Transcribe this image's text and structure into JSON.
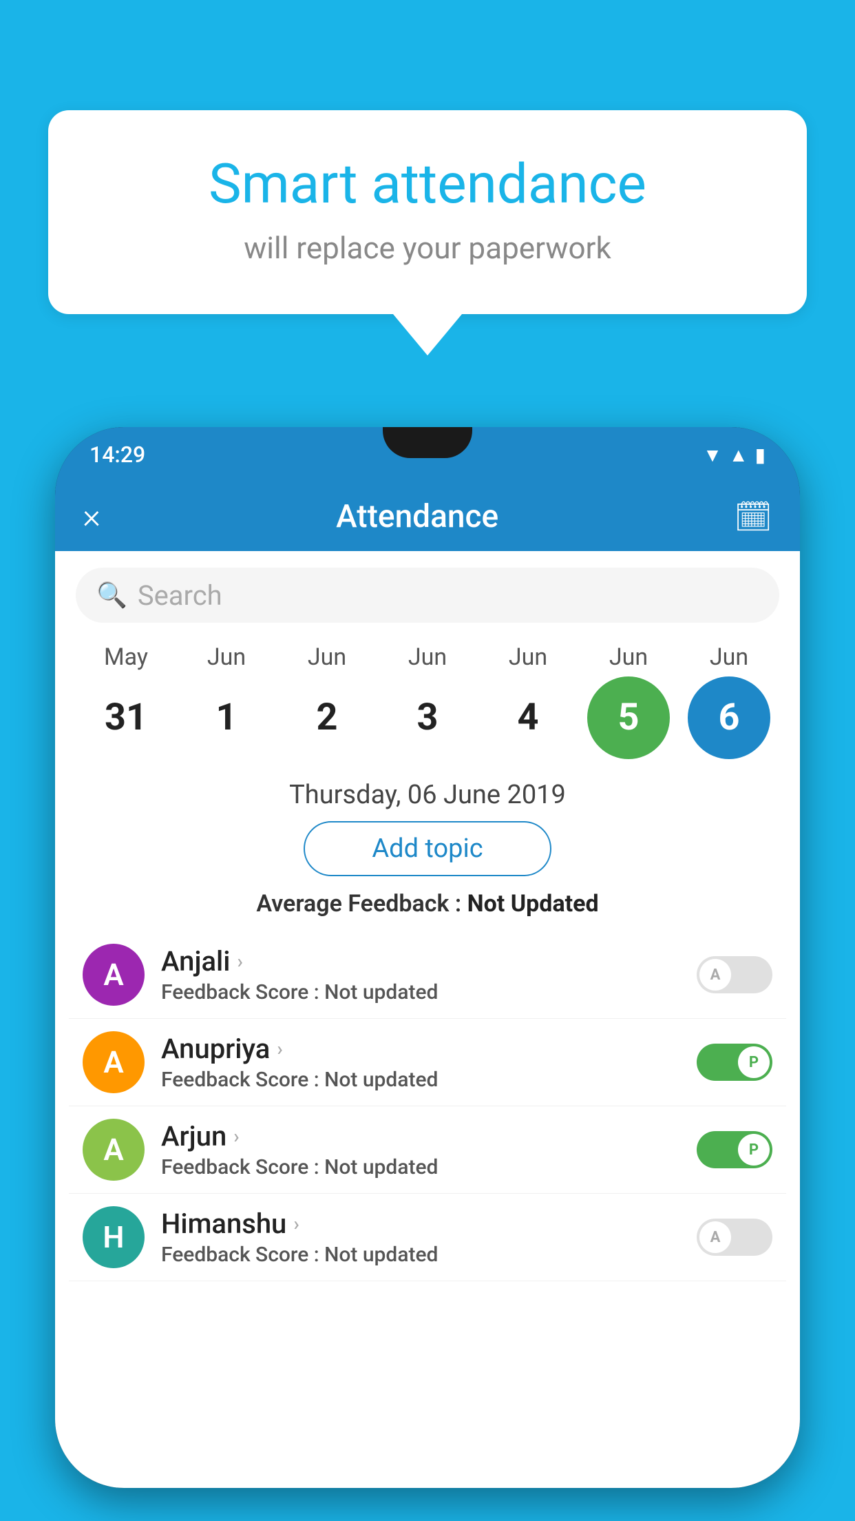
{
  "background_color": "#1ab4e8",
  "speech_bubble": {
    "title": "Smart attendance",
    "subtitle": "will replace your paperwork"
  },
  "phone": {
    "status_bar": {
      "time": "14:29",
      "icons": [
        "wifi",
        "signal",
        "battery"
      ]
    },
    "header": {
      "close_icon": "×",
      "title": "Attendance",
      "calendar_icon": "📅"
    },
    "search": {
      "placeholder": "Search"
    },
    "calendar": {
      "months": [
        "May",
        "Jun",
        "Jun",
        "Jun",
        "Jun",
        "Jun",
        "Jun"
      ],
      "days": [
        "31",
        "1",
        "2",
        "3",
        "4",
        "5",
        "6"
      ],
      "today_index": 5,
      "selected_index": 6
    },
    "selected_date": "Thursday, 06 June 2019",
    "add_topic_label": "Add topic",
    "avg_feedback_label": "Average Feedback :",
    "avg_feedback_value": "Not Updated",
    "students": [
      {
        "name": "Anjali",
        "initial": "A",
        "avatar_color": "avatar-purple",
        "feedback_label": "Feedback Score :",
        "feedback_value": "Not updated",
        "attendance": "A",
        "toggle_state": "off"
      },
      {
        "name": "Anupriya",
        "initial": "A",
        "avatar_color": "avatar-orange",
        "feedback_label": "Feedback Score :",
        "feedback_value": "Not updated",
        "attendance": "P",
        "toggle_state": "on"
      },
      {
        "name": "Arjun",
        "initial": "A",
        "avatar_color": "avatar-green-light",
        "feedback_label": "Feedback Score :",
        "feedback_value": "Not updated",
        "attendance": "P",
        "toggle_state": "on"
      },
      {
        "name": "Himanshu",
        "initial": "H",
        "avatar_color": "avatar-teal",
        "feedback_label": "Feedback Score :",
        "feedback_value": "Not updated",
        "attendance": "A",
        "toggle_state": "off"
      }
    ]
  }
}
